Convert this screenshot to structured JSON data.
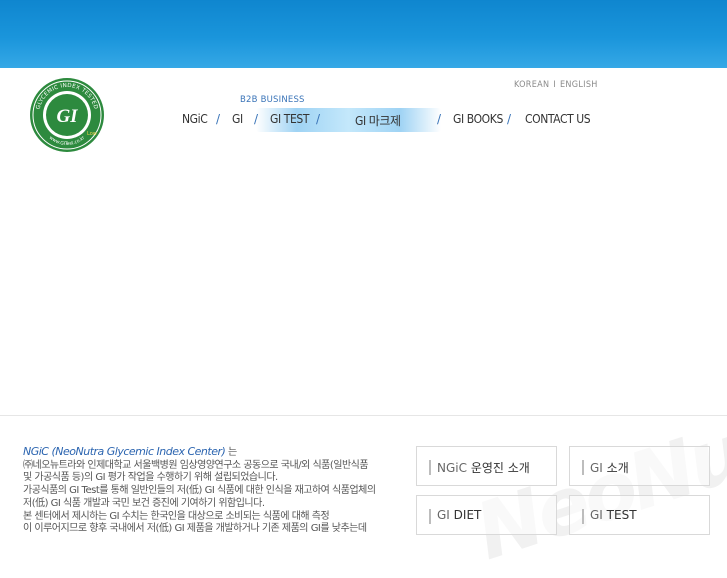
{
  "lang": {
    "korean": "KOREAN",
    "english": "ENGLISH",
    "separator": "I"
  },
  "logo": {
    "ring_text": "GLYCEMIC INDEX TESTED",
    "center": "GI",
    "bottom_text": "www.GITest.co.kr",
    "badge": "Low"
  },
  "nav": {
    "b2b": "B2B BUSINESS",
    "items": [
      {
        "label": "NGiC"
      },
      {
        "label": "GI"
      },
      {
        "label": "GI TEST"
      },
      {
        "label": "GI 마크제"
      },
      {
        "label": "GI BOOKS"
      },
      {
        "label": "CONTACT US"
      }
    ],
    "slash": "/"
  },
  "intro": {
    "lead": "NGiC (NeoNutra Glycemic Index Center)",
    "lead_suffix": " 는",
    "lines": [
      "㈜네오뉴트라와 인제대학교 서울백병원 임상영양연구소 공동으로 국내/외 식품(일반식품",
      "및 가공식품 등)의 GI 평가 작업을 수행하기 위해 설립되었습니다.",
      "가공식품의 GI Test를 통해 일반인들의 저(低) GI 식품에 대한 인식을 재고하여 식품업체의",
      "저(低) GI 식품 개발과 국민 보건 증진에 기여하기 위함입니다.",
      "본 센터에서 제시하는 GI 수치는 한국인을 대상으로 소비되는 식품에 대해 측정",
      "이 이루어지므로 향후 국내에서 저(低) GI 제품을 개발하거나 기존 제품의 GI를 낮추는데"
    ]
  },
  "watermark": "NeoNutra",
  "tiles": [
    {
      "pre": "NGiC",
      "label": " 운영진 소개"
    },
    {
      "pre": "GI",
      "label": " 소개"
    },
    {
      "pre": "GI",
      "label": " DIET"
    },
    {
      "pre": "GI",
      "label": " TEST"
    }
  ]
}
